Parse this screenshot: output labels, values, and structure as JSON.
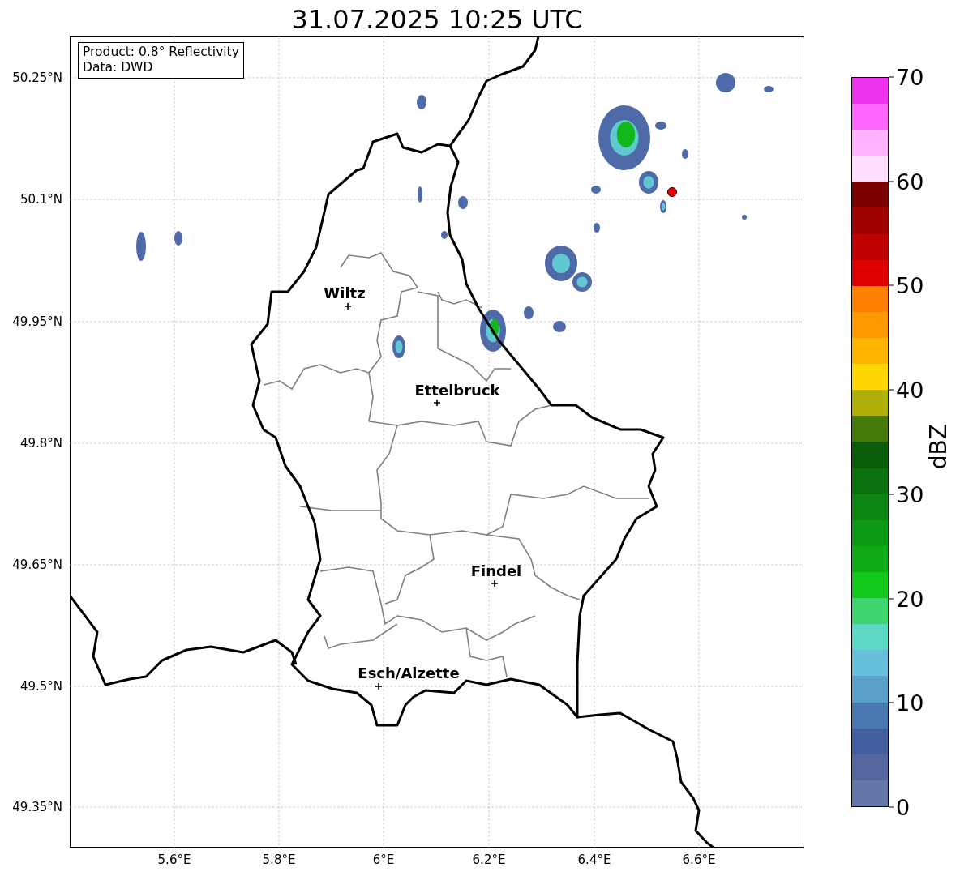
{
  "title": "31.07.2025 10:25 UTC",
  "info_box": [
    "Product: 0.8° Reflectivity",
    "Data: DWD"
  ],
  "y_ticks": [
    "50.25°N",
    "50.1°N",
    "49.95°N",
    "49.8°N",
    "49.65°N",
    "49.5°N",
    "49.35°N"
  ],
  "x_ticks": [
    "5.6°E",
    "5.8°E",
    "6°E",
    "6.2°E",
    "6.4°E",
    "6.6°E"
  ],
  "cities": [
    {
      "name": "Wiltz"
    },
    {
      "name": "Ettelbruck"
    },
    {
      "name": "Findel"
    },
    {
      "name": "Esch/Alzette"
    }
  ],
  "colorbar": {
    "label": "dBZ",
    "ticks": [
      "70",
      "60",
      "50",
      "40",
      "30",
      "20",
      "10",
      "0"
    ],
    "bins": [
      {
        "color": "#6576a8"
      },
      {
        "color": "#55679e"
      },
      {
        "color": "#4460a0"
      },
      {
        "color": "#4a78b0"
      },
      {
        "color": "#5aa0c8"
      },
      {
        "color": "#66c0dc"
      },
      {
        "color": "#5dd8c4"
      },
      {
        "color": "#3ed56f"
      },
      {
        "color": "#12c81a"
      },
      {
        "color": "#10aa16"
      },
      {
        "color": "#0e9a14"
      },
      {
        "color": "#0c8512"
      },
      {
        "color": "#0a730f"
      },
      {
        "color": "#0a5e0a"
      },
      {
        "color": "#467a0a"
      },
      {
        "color": "#b0b00a"
      },
      {
        "color": "#ffd700"
      },
      {
        "color": "#ffb400"
      },
      {
        "color": "#ff9900"
      },
      {
        "color": "#ff7f00"
      },
      {
        "color": "#e00000"
      },
      {
        "color": "#c00000"
      },
      {
        "color": "#a00000"
      },
      {
        "color": "#7a0000"
      },
      {
        "color": "#ffdfff"
      },
      {
        "color": "#ffb4ff"
      },
      {
        "color": "#ff66ff"
      },
      {
        "color": "#ee33ee"
      }
    ]
  }
}
